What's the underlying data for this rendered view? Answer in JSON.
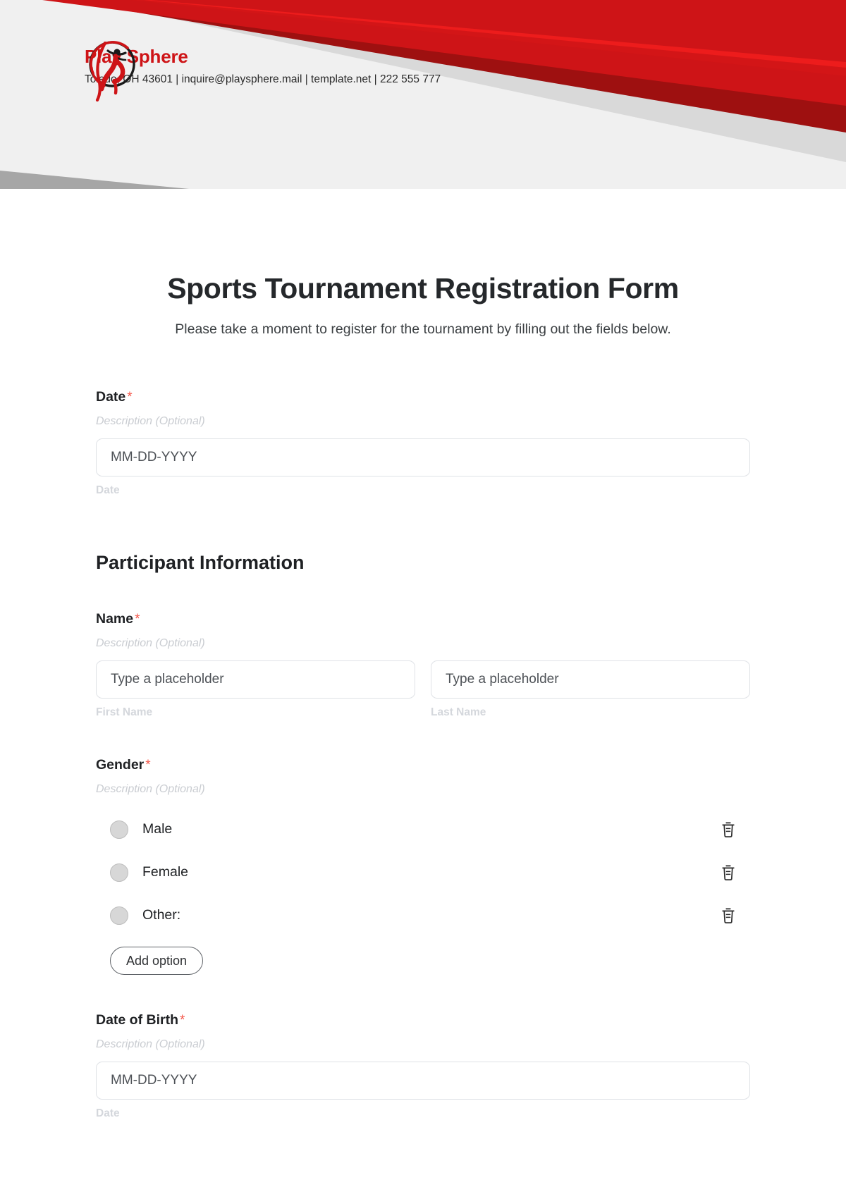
{
  "header": {
    "logo_icon": "running-figure-circle-logo",
    "brand_name": "Play Sphere",
    "contact": "Toledo, OH 43601 | inquire@playsphere.mail | template.net | 222 555 777",
    "colors": {
      "brand_red": "#CE1417",
      "bright_red": "#ED1C1C",
      "dark_red": "#9E1010",
      "light_gray": "#D9D9D9",
      "mid_gray": "#A6A6A6",
      "panel_gray": "#F0F0F0"
    }
  },
  "form": {
    "title": "Sports Tournament Registration Form",
    "subtitle": "Please take a moment to register for the tournament by filling out the fields below.",
    "required_marker": "*",
    "description_placeholder": "Description (Optional)",
    "date_field": {
      "label": "Date",
      "description": "Description (Optional)",
      "placeholder": "MM-DD-YYYY",
      "sub_label": "Date"
    },
    "section_heading": "Participant Information",
    "name_field": {
      "label": "Name",
      "description": "Description (Optional)",
      "first": {
        "placeholder": "Type a placeholder",
        "sub_label": "First Name"
      },
      "last": {
        "placeholder": "Type a placeholder",
        "sub_label": "Last Name"
      }
    },
    "gender_field": {
      "label": "Gender",
      "description": "Description (Optional)",
      "options": [
        {
          "label": "Male",
          "delete_icon": "trash-icon"
        },
        {
          "label": "Female",
          "delete_icon": "trash-icon"
        },
        {
          "label": "Other:",
          "delete_icon": "trash-icon"
        }
      ],
      "add_option_label": "Add option"
    },
    "dob_field": {
      "label": "Date of Birth",
      "description": "Description (Optional)",
      "placeholder": "MM-DD-YYYY",
      "sub_label": "Date"
    }
  }
}
